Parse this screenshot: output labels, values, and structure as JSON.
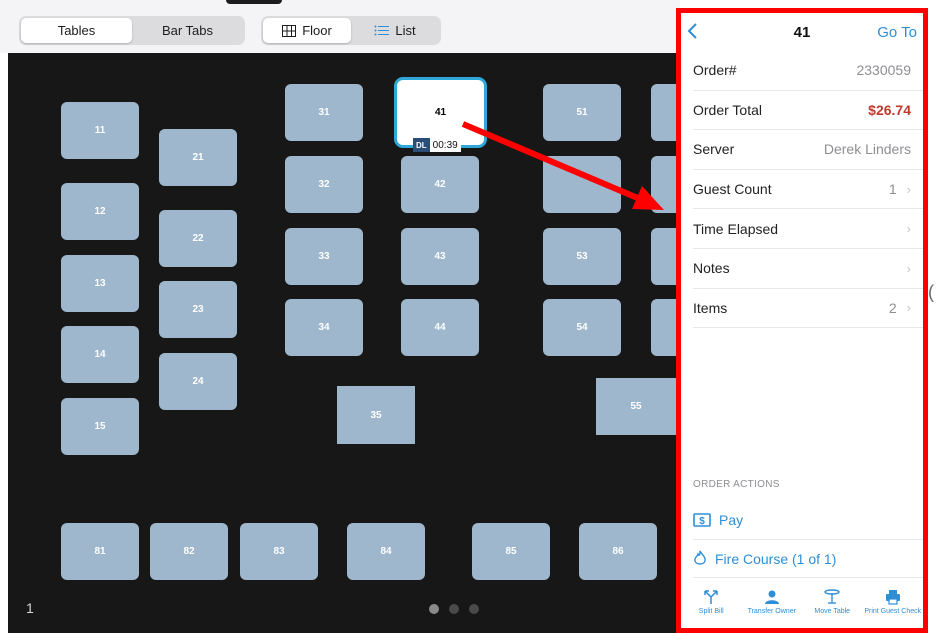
{
  "topbar": {
    "tabs": [
      "Tables",
      "Bar Tabs"
    ],
    "views": [
      "Floor",
      "List"
    ]
  },
  "floor": {
    "tables": [
      "11",
      "12",
      "13",
      "14",
      "15",
      "21",
      "22",
      "23",
      "24",
      "31",
      "32",
      "33",
      "34",
      "35",
      "41",
      "42",
      "43",
      "44",
      "51",
      "53",
      "54",
      "55",
      "81",
      "82",
      "83",
      "84",
      "85",
      "86"
    ],
    "selected_table": "41",
    "server_initials": "DL",
    "elapsed_badge": "00:39",
    "page_number": "1"
  },
  "panel": {
    "title": "41",
    "goto_label": "Go To",
    "rows": [
      {
        "label": "Order#",
        "value": ""
      },
      {
        "label": "Order Total",
        "value": "$26.74"
      },
      {
        "label": "Server",
        "value": "Derek Linders"
      },
      {
        "label": "Guest Count",
        "value": "1"
      },
      {
        "label": "Time Elapsed",
        "value": ""
      },
      {
        "label": "Notes",
        "value": ""
      },
      {
        "label": "Items",
        "value": "2"
      }
    ],
    "order_number": "2330059",
    "section_label": "ORDER ACTIONS",
    "actions": [
      "Pay",
      "Fire Course (1 of 1)"
    ],
    "tools": [
      "Split Bill",
      "Transfer Owner",
      "Move Table",
      "Print Guest Check"
    ]
  },
  "colors": {
    "table": "#9eb7cc",
    "accent": "#2e8ed6",
    "highlight": "#ff0000",
    "total": "#c0392b"
  }
}
